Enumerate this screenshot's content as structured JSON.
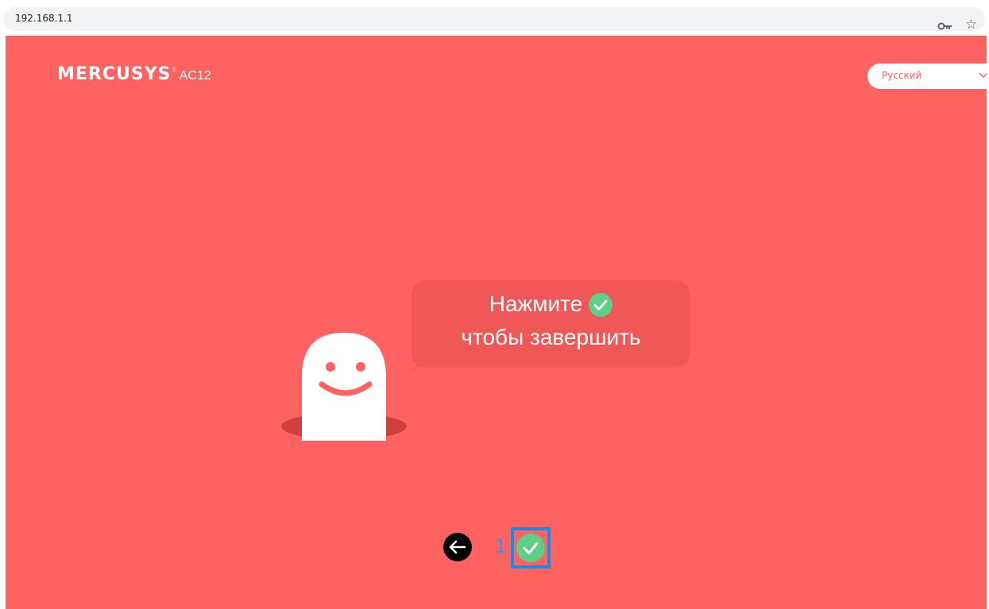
{
  "browser": {
    "url": "192.168.1.1",
    "icons": [
      "key-icon",
      "star-icon"
    ]
  },
  "header": {
    "brand_name": "MERCUSYS",
    "brand_reg": "®",
    "model": "AC12",
    "language_selected": "Русский"
  },
  "bubble": {
    "line1": "Нажмите",
    "line2": "чтобы завершить"
  },
  "nav": {
    "step_number": "1"
  },
  "colors": {
    "page_background": "#ff6361",
    "bubble_background": "#f05857",
    "check_green": "#5ecf84",
    "highlight_blue": "#1e88e5",
    "step_number_blue": "#3d8ef0"
  }
}
